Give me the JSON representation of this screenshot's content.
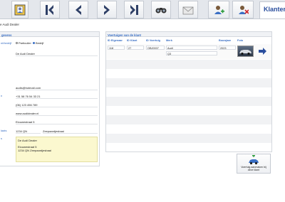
{
  "toolbar": {
    "buttons": [
      {
        "name": "profile-card-button",
        "icon": "profile-card-icon"
      },
      {
        "name": "first-record-button",
        "icon": "first-record-icon"
      },
      {
        "name": "previous-record-button",
        "icon": "previous-record-icon"
      },
      {
        "name": "next-record-button",
        "icon": "next-record-icon"
      },
      {
        "name": "last-record-button",
        "icon": "last-record-icon"
      },
      {
        "name": "search-binoculars-button",
        "icon": "binoculars-icon"
      },
      {
        "name": "mail-button",
        "icon": "envelope-icon"
      },
      {
        "name": "add-customer-button",
        "icon": "add-user-icon"
      },
      {
        "name": "delete-customer-button",
        "icon": "delete-user-icon"
      }
    ],
    "active_tab": "Klanten"
  },
  "breadcrumb": "e Audi Dealer",
  "customer": {
    "section_title": "gevens",
    "type_label": "nt/bedrijf",
    "type_options": [
      "Particulier",
      "Bedrijf"
    ],
    "type_selected": "Bedrijf",
    "name": "De Audi Dealer",
    "email": "audis@hotmail.com",
    "phone_label": "n",
    "phone": "+31 58 76 54 33 21",
    "phone2": "(06) 123 456 789",
    "website": "www.audidealer.nl",
    "address": "Eiouwestraat 5",
    "postcode_label": "laats",
    "postcode": "1234 QN",
    "city": "Zeepaardjesbaai",
    "notes_label": "s",
    "notes_lines": [
      "De Audi Dealer",
      "",
      "Eiouwestraat 5",
      "1234 QN Zeepaardjesbaai"
    ]
  },
  "vehicles": {
    "title": "Voertuigen van de klant",
    "columns": [
      "ID Eigenaar",
      "ID Klant",
      "ID Voertuig",
      "Merk",
      "Bouwjaar",
      "Foto"
    ],
    "rows": [
      {
        "id_eigenaar": "118",
        "id_klant": "27",
        "id_voertuig": "OBJ0007",
        "merk": "Audi",
        "model": "Q3",
        "bouwjaar": "2023"
      }
    ]
  },
  "add_vehicle": {
    "label_line1": "Voertuig aanmaken bij",
    "label_line2": "deze klant"
  },
  "colors": {
    "accent": "#3a6fc4",
    "toolbar_bg": "#e4e7ec",
    "notes_bg": "#fbf8cf"
  }
}
